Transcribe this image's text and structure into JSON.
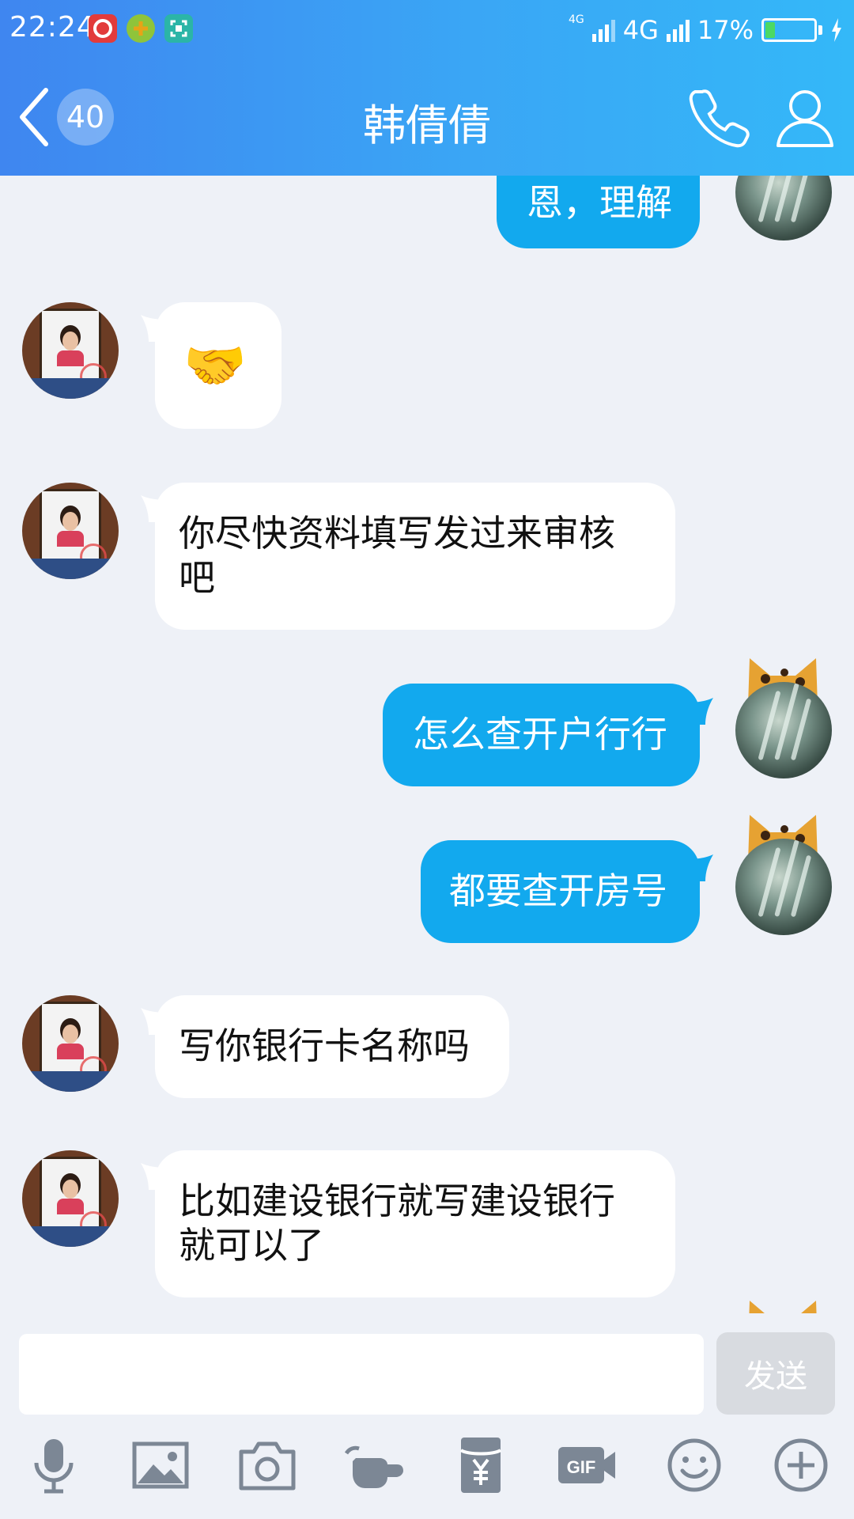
{
  "status_bar": {
    "time": "22:24",
    "network_small": "4G",
    "network": "4G",
    "battery": "17%"
  },
  "header": {
    "back_badge": "40",
    "title": "韩倩倩"
  },
  "messages": [
    {
      "from": "me",
      "text": "恩，理解"
    },
    {
      "from": "peer",
      "text": "🤝"
    },
    {
      "from": "peer",
      "text": "你尽快资料填写发过来审核\n吧"
    },
    {
      "from": "me",
      "text": "怎么查开户行行"
    },
    {
      "from": "me",
      "text": "都要查开房号"
    },
    {
      "from": "peer",
      "text": "写你银行卡名称吗"
    },
    {
      "from": "peer",
      "text": "比如建设银行就写建设银行\n就可以了"
    }
  ],
  "input": {
    "value": "",
    "placeholder": "",
    "send_label": "发送"
  },
  "toolbar": {
    "items": [
      "mic-icon",
      "image-icon",
      "camera-icon",
      "poke-icon",
      "red-packet-icon",
      "gif-icon",
      "emoji-icon",
      "plus-icon"
    ]
  },
  "colors": {
    "header_start": "#3f86f0",
    "header_end": "#34b8f8",
    "my_bubble": "#12a9ee",
    "peer_bubble": "#ffffff",
    "background": "#eef1f7"
  }
}
